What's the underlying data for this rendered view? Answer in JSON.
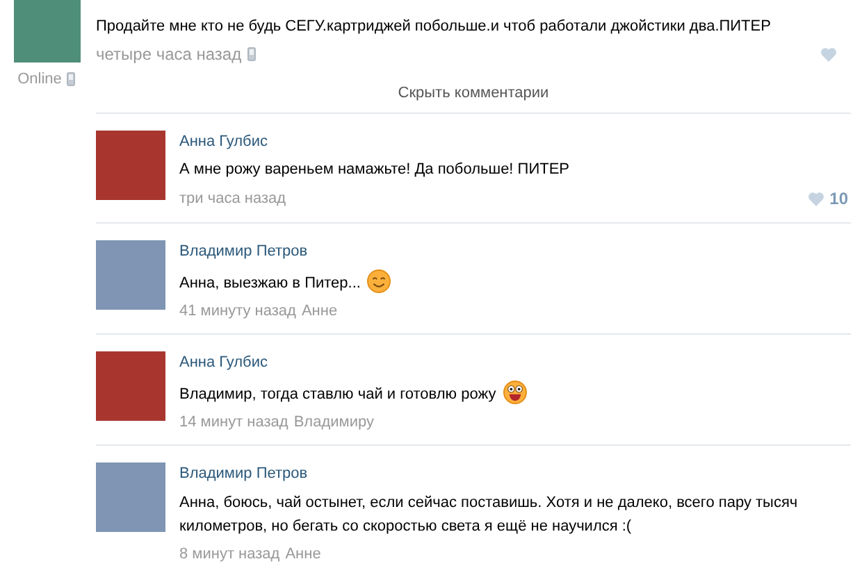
{
  "post": {
    "text": "Продайте мне кто не будь СЕГУ.картриджей побольше.и чтоб работали джойстики два.ПИТЕР",
    "time": "четыре часа назад",
    "status": "Online"
  },
  "hide_comments": "Скрыть комментарии",
  "comments": [
    {
      "author": "Анна Гулбис",
      "color": "#a8362f",
      "text": "А мне рожу вареньем намажьте! Да побольше! ПИТЕР",
      "time": "три часа назад",
      "likes": "10"
    },
    {
      "author": "Владимир Петров",
      "color": "#7f95b3",
      "text": "Анна, выезжаю в Питер...",
      "emoji": {
        "kind": "smile"
      },
      "time": "41 минуту назад",
      "reply_to": "Анне"
    },
    {
      "author": "Анна Гулбис",
      "color": "#a8362f",
      "text": "Владимир, тогда ставлю чай и готовлю рожу",
      "emoji": {
        "kind": "grin"
      },
      "time": "14 минут назад",
      "reply_to": "Владимиру"
    },
    {
      "author": "Владимир Петров",
      "color": "#7f95b3",
      "text": "Анна, боюсь, чай остынет, если сейчас поставишь. Хотя и не далеко, всего пару тысяч километров, но бегать со скоростью света я ещё не научился :(",
      "time": "8 минут назад",
      "reply_to": "Анне"
    }
  ]
}
